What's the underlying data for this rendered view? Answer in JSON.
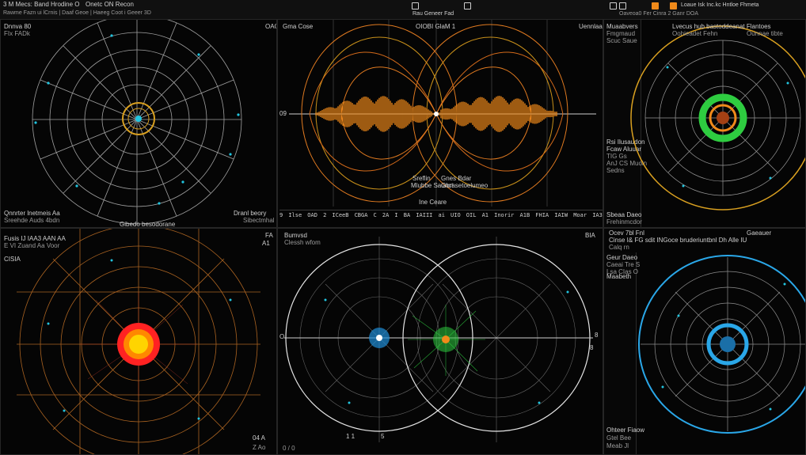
{
  "topbar": {
    "left_title": "3 M Mecs: Band Hrodine O",
    "left_mid": "Onetc ON Recon",
    "left_menu": "Rawme Fazn ui lCrnis | Daaf Geoe | Haeeg Coot i Geeer 3D",
    "center_title": "Rau Geneer Fad",
    "right_title": "Loaue Isk Inc.kc Hntloe Fhmeta",
    "right_sub": "Oaveoa0 Fer Cinra 2 Ganr DOA"
  },
  "panels": {
    "top_left": {
      "label_tl": "Dnnva 80",
      "label_tl2": "FIx FADk",
      "label_tr": "OAO",
      "label_bl": "Qnnrter lnetmeis Aa",
      "label_bl2": "Sreehde Auds 4bdn",
      "label_br": "Dranl beory",
      "label_br2": "Sibectmhal",
      "label_bc": "Gibedo besodorane"
    },
    "top_center": {
      "label_tl": "Gma Cose",
      "label_tc": "OIOBI GlaM 1",
      "label_tr": "Uennlaa",
      "axis_left": "09",
      "legend1": "Sreflin",
      "legend1b": "Mlubbe Saunct",
      "legend2": "Gnes Bdar",
      "legend2b": "Gbrasetoelumeo",
      "legend3": "Ine Ceare",
      "timeline": [
        "9",
        "Ilse",
        "OAD",
        "2",
        "ICeeB",
        "CBGA",
        "C",
        "2A",
        "I",
        "BA",
        "IAIII",
        "ai",
        "UIO",
        "OIL",
        "A1",
        "Inorir",
        "A1B",
        "FHIA",
        "IAIW",
        "Moar",
        "IA3"
      ]
    },
    "top_right": {
      "side_title": "Muaabvers",
      "side_lines": [
        "Fmgmaud",
        "Scuc Saue"
      ],
      "side_mid": [
        "Rsi Ilusaudon",
        "Fcaw Aluuar",
        "TIG Gs",
        "AnJ CS Muoln",
        "Sedns"
      ],
      "side_bottom": [
        "Sbeaa Daeo",
        "Frehinmcdor"
      ],
      "label_top": "Lvecus hub bastoddeanat Flantoes",
      "label_top2": "Oohieadet Fehn",
      "label_top3": "Ounnae tibte"
    },
    "bottom_left": {
      "label_tl": "Fusis IJ IAA3 AAN AA",
      "label_tl2": "E VI Zuand Aa Voor",
      "label_tl3": "CISIA",
      "label_tr": "FA",
      "label_br": "04 A",
      "label_br2": "Z Ao",
      "label_mid": "A1"
    },
    "bottom_center": {
      "label_tl": "Bumvsd",
      "label_tl2": "Clessh wfom",
      "axis_left": "O",
      "axis_right": "8",
      "label_tr": "BIA",
      "label_r": "8",
      "label_bl": "1 1",
      "label_bc": "5",
      "label_bl2": "0 / 0"
    },
    "bottom_right": {
      "header": "Ocev 7bl Fnl",
      "header2": "Cinse I& FG sdit INGoce bruderiuntbnl Dh Alle IU",
      "header3": "Calq rn",
      "header_r": "Gaeauer",
      "side_lines": [
        "Geur Daeo",
        "Caeai Tre S",
        "Lsa CIas  O"
      ],
      "side_mid": "Maabeth",
      "side_bottom": [
        "Ohteer Fiaow",
        "Gtel Bee",
        "Meab Jl"
      ]
    }
  },
  "colors": {
    "grid": "#bfbfbf",
    "orange": "#f08a1a",
    "cyan": "#22c5e0",
    "green": "#2ecc40",
    "red": "#ff2222",
    "yellow": "#ffd400",
    "blue": "#2aa7e8",
    "gold": "#d9a020"
  }
}
